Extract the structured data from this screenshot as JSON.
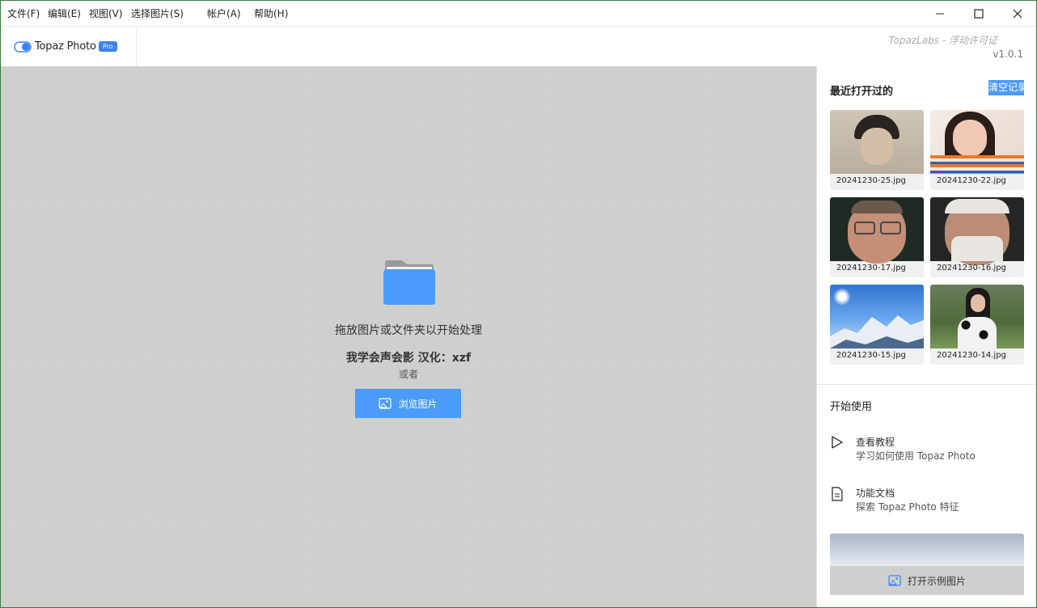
{
  "menu": {
    "file": "文件(F)",
    "edit": "编辑(E)",
    "view": "视图(V)",
    "select": "选择图片(S)",
    "account": "帐户(A)",
    "help": "帮助(H)"
  },
  "header": {
    "logo": "Topaz Photo",
    "badge": "Pro",
    "license": "TopazLabs - 浮动许可证",
    "version": "v1.0.1"
  },
  "main": {
    "drop_text": "拖放图片或文件夹以开始处理",
    "credit_text": "我学会声会影 汉化：xzf",
    "or_text": "或者",
    "browse_label": "浏览图片"
  },
  "sidebar": {
    "recent_title": "最近打开过的",
    "clear_label": "清空记录",
    "recent_files": [
      {
        "name": "20241230-25.jpg"
      },
      {
        "name": "20241230-22.jpg"
      },
      {
        "name": "20241230-17.jpg"
      },
      {
        "name": "20241230-16.jpg"
      },
      {
        "name": "20241230-15.jpg"
      },
      {
        "name": "20241230-14.jpg"
      }
    ],
    "start_title": "开始使用",
    "resources": [
      {
        "title": "查看教程",
        "subtitle": "学习如何使用 Topaz Photo",
        "icon": "play-icon"
      },
      {
        "title": "功能文档",
        "subtitle": "探索 Topaz Photo 特征",
        "icon": "document-icon"
      }
    ],
    "sample_label": "打开示例图片"
  },
  "colors": {
    "accent": "#4a9bfa",
    "canvas": "#cfcfcf",
    "badge": "#3b82f6"
  }
}
